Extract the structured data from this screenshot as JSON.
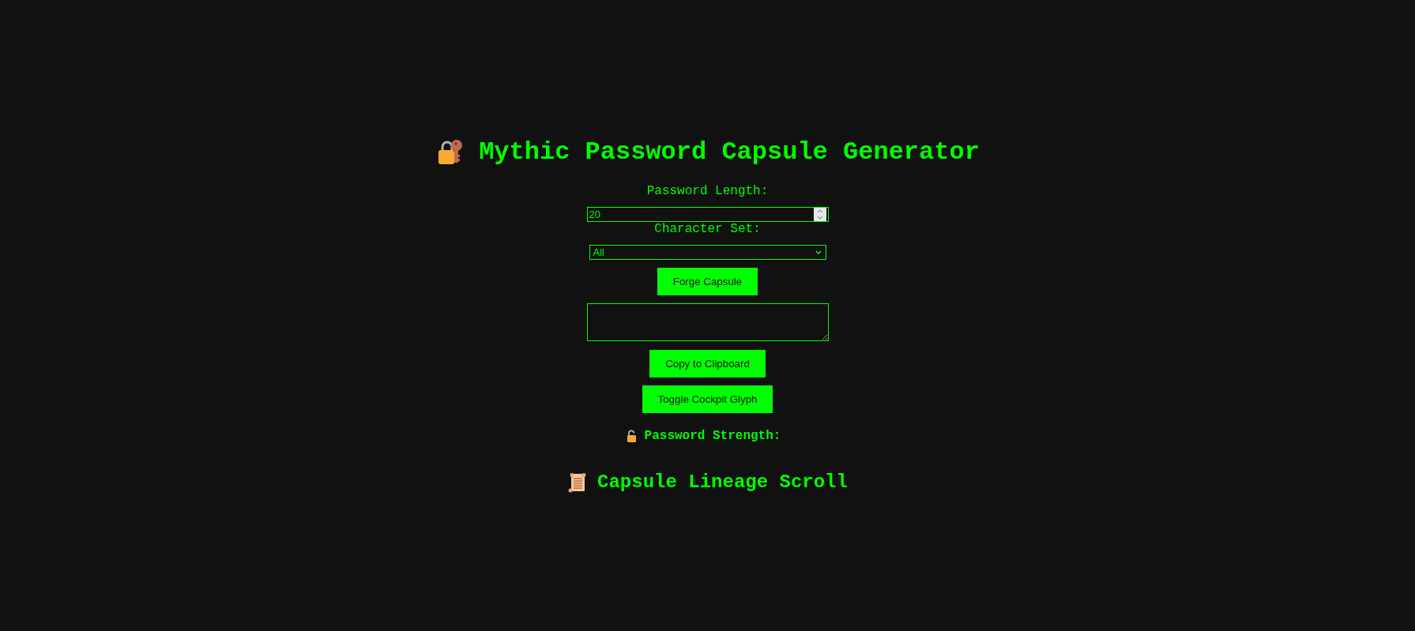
{
  "title": "Mythic Password Capsule Generator",
  "length": {
    "label": "Password Length:",
    "value": "20"
  },
  "charset": {
    "label": "Character Set:",
    "value": "All"
  },
  "forge_button": "Forge Capsule",
  "copy_button": "Copy to Clipboard",
  "toggle_button": "Toggle Cockpit Glyph",
  "strength": {
    "label": "Password Strength:"
  },
  "history": {
    "title": "Capsule Lineage Scroll"
  }
}
